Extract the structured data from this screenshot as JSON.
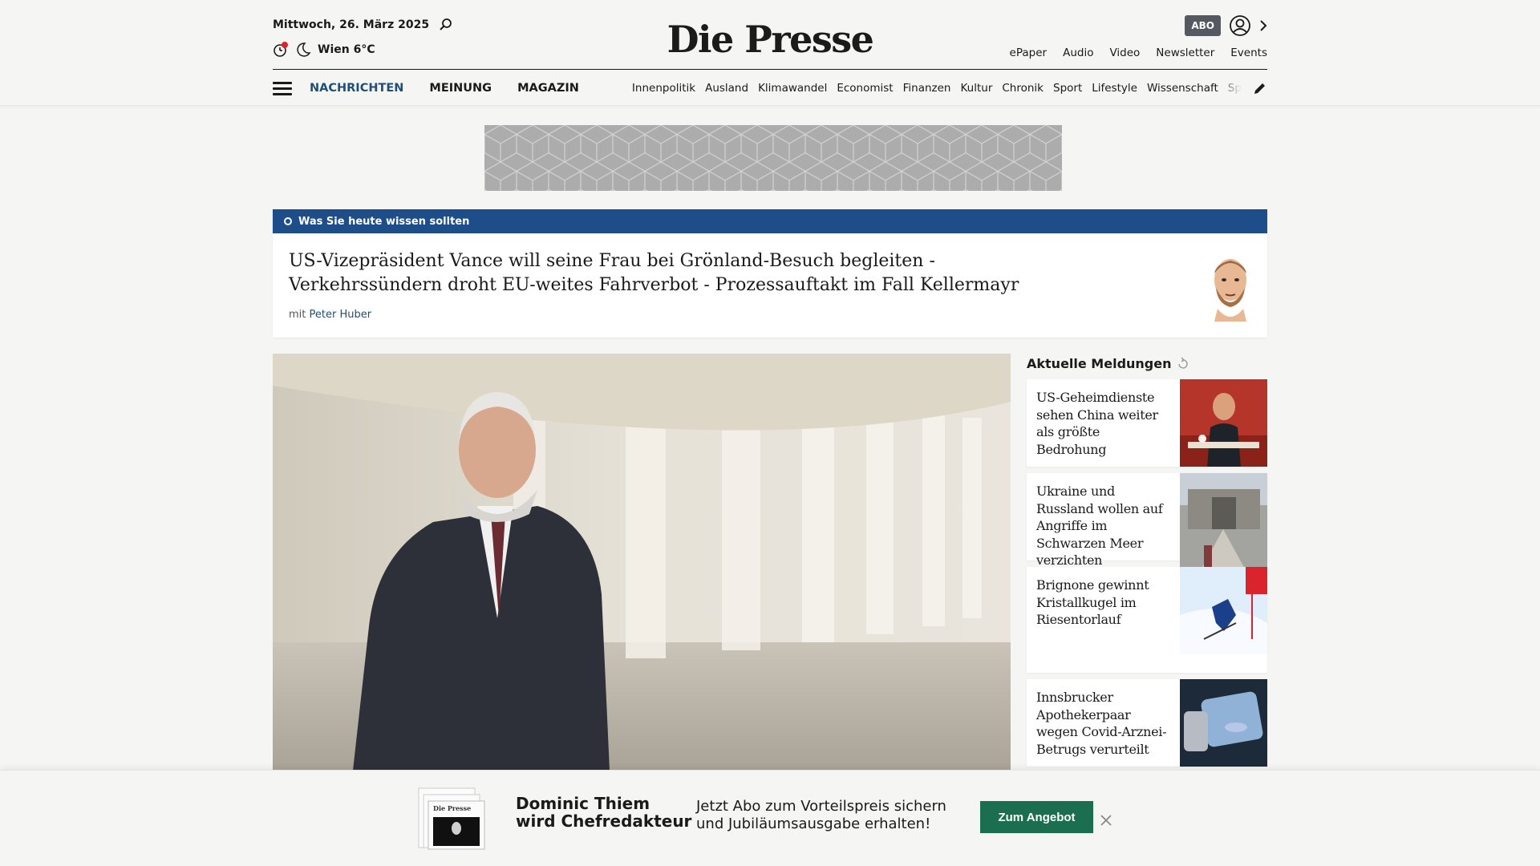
{
  "header": {
    "date": "Mittwoch, 26. März 2025",
    "weather": "Wien 6°C",
    "logo": "Die Presse",
    "abo_label": "ABO",
    "top_links": [
      "ePaper",
      "Audio",
      "Video",
      "Newsletter",
      "Events"
    ]
  },
  "nav": {
    "main": [
      "NACHRICHTEN",
      "MEINUNG",
      "MAGAZIN"
    ],
    "sub": [
      "Innenpolitik",
      "Ausland",
      "Klimawandel",
      "Economist",
      "Finanzen",
      "Kultur",
      "Chronik",
      "Sport",
      "Lifestyle",
      "Wissenschaft",
      "Spectrum"
    ]
  },
  "wissen": {
    "label": "Was Sie heute wissen sollten",
    "headline": "US-Vizepräsident Vance will seine Frau bei Grönland-Besuch begleiten - Verkehrssündern droht EU-weites Fahrverbot - Prozessauftakt im Fall Kellermayr",
    "by_prefix": "mit",
    "author": "Peter Huber"
  },
  "aktuell": {
    "title": "Aktuelle Meldungen",
    "items": [
      {
        "text": "US-Geheimdienste sehen China weiter als größte Bedrohung"
      },
      {
        "text": "Ukraine und Russland wollen auf Angriffe im Schwarzen Meer verzichten"
      },
      {
        "text": "Brignone gewinnt Kristallkugel im Riesentorlauf"
      },
      {
        "text": "Innsbrucker Apothekerpaar wegen Covid-Arznei-Betrugs verurteilt"
      }
    ]
  },
  "promo": {
    "headline_line1": "Dominic Thiem",
    "headline_line2": "wird Chefredakteur",
    "text_line1": "Jetzt Abo zum Vorteilspreis sichern",
    "text_line2": "und Jubiläumsausgabe erhalten!",
    "button": "Zum Angebot",
    "book_logo": "Die Presse"
  },
  "colors": {
    "nav_active": "#1f4e79",
    "wissen_bar": "#1d4e8a",
    "promo_button": "#1b6e50",
    "background": "#f5f5f3"
  }
}
